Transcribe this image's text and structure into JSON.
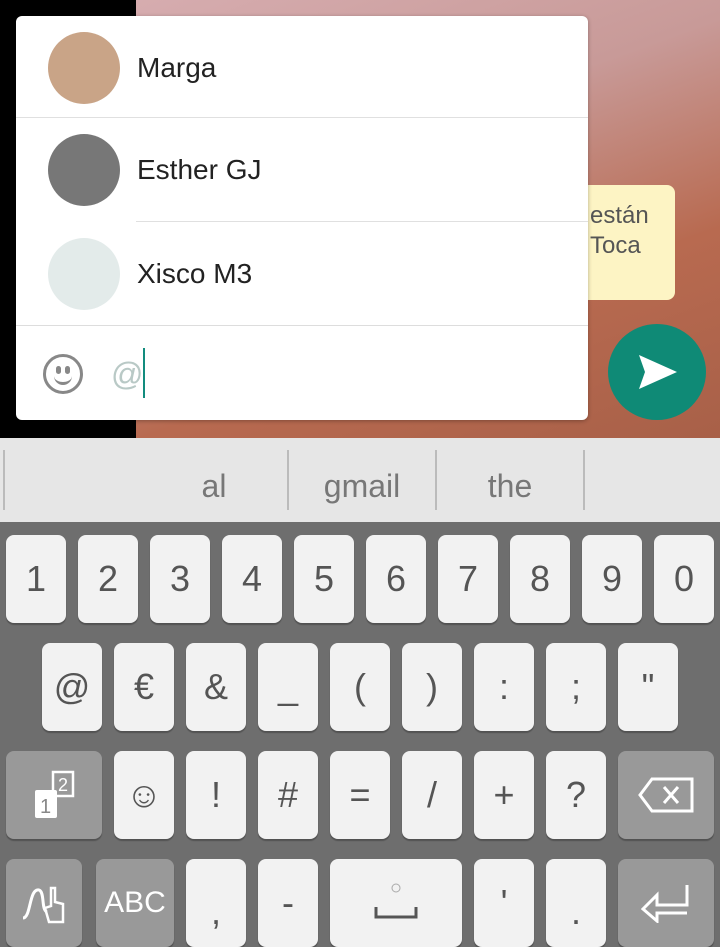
{
  "chat": {
    "bubble_text": [
      "están",
      "Toca"
    ]
  },
  "mentions": [
    {
      "name": "Marga",
      "avatar": "#c9a487"
    },
    {
      "name": "Esther GJ",
      "avatar": "#777777"
    },
    {
      "name": "Xisco M3",
      "avatar": "#e3ebea"
    }
  ],
  "input": {
    "value": "@",
    "emoji_icon": "smiley-icon",
    "send_icon": "send-icon"
  },
  "colors": {
    "accent": "#0f8a76",
    "keyboard_bg": "#6e6e6e",
    "key": "#f2f2f2"
  },
  "suggestions": [
    "al",
    "gmail",
    "the"
  ],
  "keyboard": {
    "row1": [
      "1",
      "2",
      "3",
      "4",
      "5",
      "6",
      "7",
      "8",
      "9",
      "0"
    ],
    "row2": [
      "@",
      "€",
      "&",
      "_",
      "(",
      ")",
      ":",
      ";",
      "\""
    ],
    "row3": [
      "☺",
      "!",
      "#",
      "=",
      "/",
      "+",
      "?"
    ],
    "row4": {
      "abc": "ABC",
      "comma": ",",
      "dash": "-",
      "apostrophe": "'",
      "period": "."
    }
  }
}
